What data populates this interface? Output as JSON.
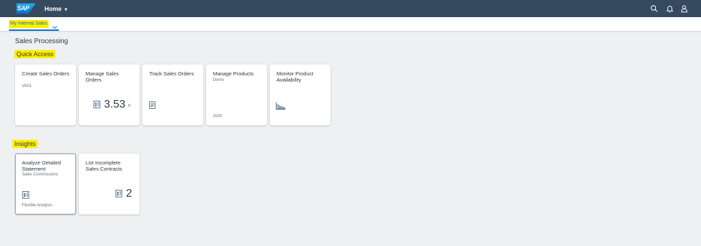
{
  "shell": {
    "logo_text": "SAP",
    "home_label": "Home",
    "home_caret": "▾",
    "icons": [
      "search-icon",
      "bell-icon",
      "user-icon"
    ]
  },
  "subheader": {
    "group_label": "My Internal Sales",
    "chevron": "chevron-down-icon"
  },
  "page": {
    "section_title": "Sales Processing",
    "groups": [
      {
        "title": "Quick Access",
        "tiles": [
          {
            "title": "Create Sales Orders",
            "subtitle": "VA01"
          },
          {
            "title": "Manage Sales Orders",
            "kpi_value": "3.53",
            "kpi_scale": "K",
            "icon": "sales-document-icon"
          },
          {
            "title": "Track Sales Orders",
            "icon": "list-document-icon"
          },
          {
            "title": "Manage Products",
            "subtitle": "Demo",
            "footer": "2020"
          },
          {
            "title": "Monitor Product Availability",
            "icon": "factory-chart-icon"
          }
        ]
      },
      {
        "title": "Insights",
        "tiles": [
          {
            "title": "Analyze Detailed Statement",
            "subtitle": "Sales Commissions",
            "footer": "Flexible Analysis",
            "icon": "sales-document-icon"
          },
          {
            "title": "List Incomplete Sales Contracts",
            "kpi_value": "2",
            "icon": "sales-document-icon"
          }
        ]
      }
    ]
  },
  "colors": {
    "shell_bg": "#354a5f",
    "accent": "#0a6ed1",
    "highlight": "#fcf000",
    "page_bg": "#eef0f1"
  }
}
